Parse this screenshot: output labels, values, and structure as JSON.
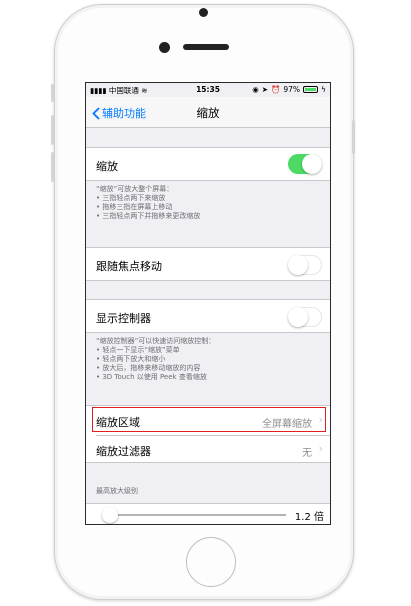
{
  "status_bar": {
    "carrier": "中国联通",
    "time": "15:35",
    "battery_percent": "97%"
  },
  "nav": {
    "back_label": "辅助功能",
    "title": "缩放"
  },
  "zoom": {
    "label": "缩放",
    "enabled": true,
    "footer": [
      "“缩放”可放大整个屏幕：",
      "• 三指轻点两下来缩放",
      "• 拖移三指在屏幕上移动",
      "• 三指轻点两下并拖移来更改缩放"
    ]
  },
  "follow_focus": {
    "label": "跟随焦点移动",
    "enabled": false
  },
  "show_controller": {
    "label": "显示控制器",
    "enabled": false,
    "footer": [
      "“缩放控制器”可以快速访问缩放控制：",
      "• 轻点一下显示“缩放”菜单",
      "• 轻点两下放大和缩小",
      "• 放大后，拖移来移动缩放的内容",
      "• 3D Touch 以使用 Peek 查看缩放"
    ]
  },
  "zoom_region": {
    "label": "缩放区域",
    "value": "全屏幕缩放",
    "chevron": "›"
  },
  "zoom_filter": {
    "label": "缩放过滤器",
    "value": "无",
    "chevron": "›"
  },
  "max_zoom": {
    "header": "最高放大级别",
    "value_label": "1.2 倍",
    "fraction": 0.0
  },
  "colors": {
    "accent": "#007aff",
    "switch_on": "#4cd964",
    "highlight": "#e02020"
  }
}
